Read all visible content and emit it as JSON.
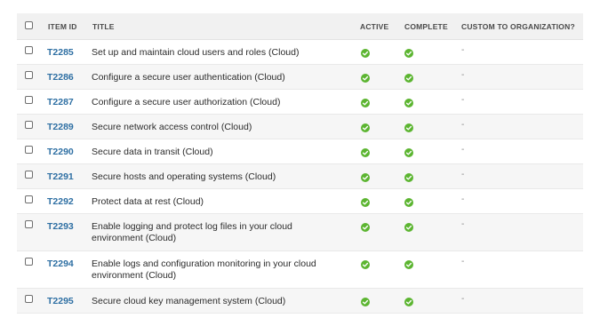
{
  "colors": {
    "link": "#2e6fa3",
    "check": "#5cb531",
    "header_bg": "#f1f1f1",
    "alt_row_bg": "#f6f6f6"
  },
  "columns": {
    "item_id": "ITEM ID",
    "title": "TITLE",
    "active": "ACTIVE",
    "complete": "COMPLETE",
    "custom": "CUSTOM TO ORGANIZATION?"
  },
  "rows": [
    {
      "id": "T2285",
      "title": "Set up and maintain cloud users and roles (Cloud)",
      "active": true,
      "complete": true,
      "custom": "-"
    },
    {
      "id": "T2286",
      "title": "Configure a secure user authentication (Cloud)",
      "active": true,
      "complete": true,
      "custom": "-"
    },
    {
      "id": "T2287",
      "title": "Configure a secure user authorization (Cloud)",
      "active": true,
      "complete": true,
      "custom": "-"
    },
    {
      "id": "T2289",
      "title": "Secure network access control (Cloud)",
      "active": true,
      "complete": true,
      "custom": "-"
    },
    {
      "id": "T2290",
      "title": "Secure data in transit (Cloud)",
      "active": true,
      "complete": true,
      "custom": "-"
    },
    {
      "id": "T2291",
      "title": "Secure hosts and operating systems (Cloud)",
      "active": true,
      "complete": true,
      "custom": "-"
    },
    {
      "id": "T2292",
      "title": "Protect data at rest (Cloud)",
      "active": true,
      "complete": true,
      "custom": "-"
    },
    {
      "id": "T2293",
      "title": "Enable logging and protect log files in your cloud environment (Cloud)",
      "active": true,
      "complete": true,
      "custom": "-"
    },
    {
      "id": "T2294",
      "title": "Enable logs and configuration monitoring in your cloud environment (Cloud)",
      "active": true,
      "complete": true,
      "custom": "-"
    },
    {
      "id": "T2295",
      "title": "Secure cloud key management system (Cloud)",
      "active": true,
      "complete": true,
      "custom": "-"
    }
  ]
}
